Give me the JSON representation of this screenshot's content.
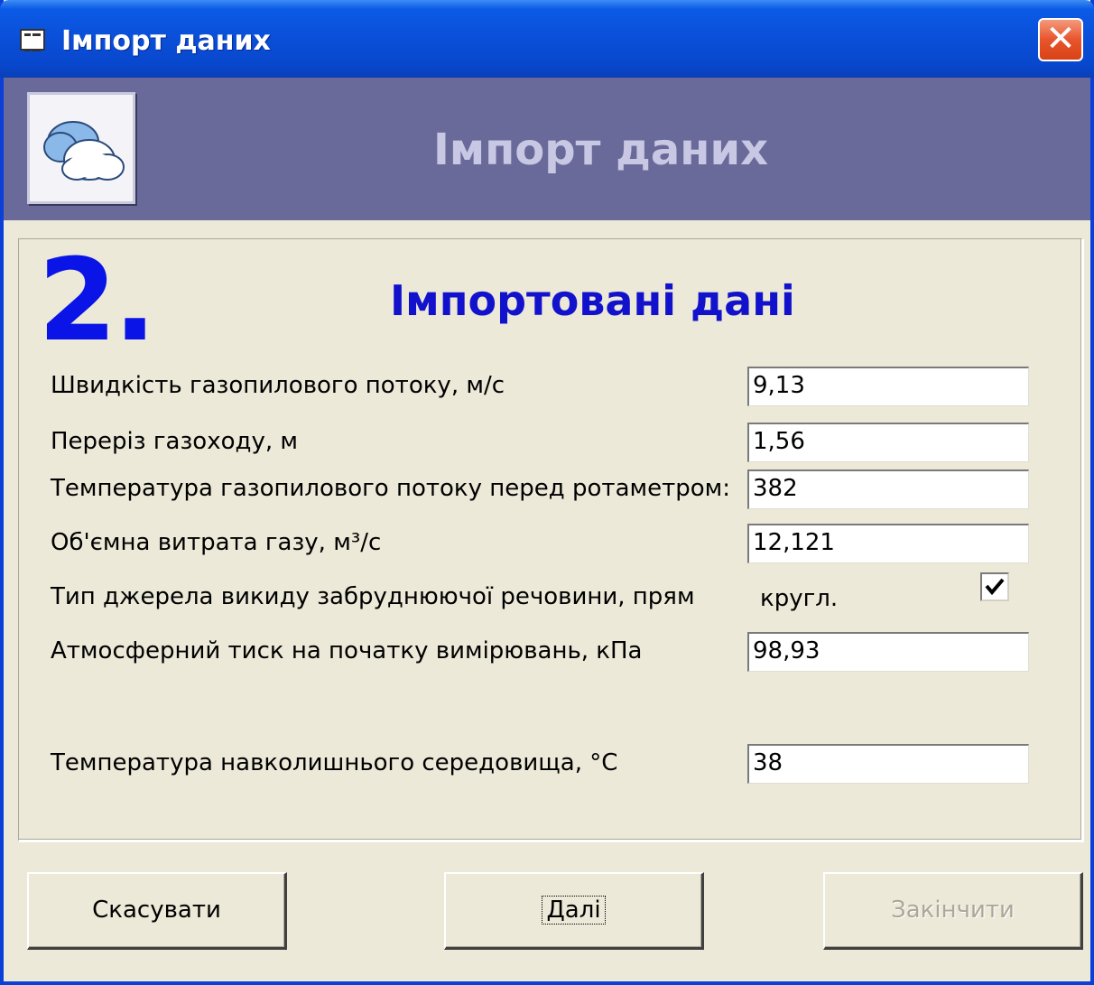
{
  "window": {
    "title": "Імпорт даних",
    "close_label": "✕"
  },
  "banner": {
    "title": "Імпорт даних",
    "icon": "clouds-icon"
  },
  "step": {
    "number": "2.",
    "title": "Імпортовані дані"
  },
  "fields": [
    {
      "label": "Швидкість газопилового потоку, м/с",
      "value": "9,13"
    },
    {
      "label": "Переріз газоходу, м",
      "value": "1,56"
    },
    {
      "label": "Температура газопилового потоку перед ротаметром:",
      "value": "382"
    },
    {
      "label": "Об'ємна витрата газу, м³/с",
      "value": "12,121"
    },
    {
      "label": "Атмосферний тиск на початку вимірювань, кПа",
      "value": "98,93"
    },
    {
      "label": "Температура навколишнього середовища, °С",
      "value": "38"
    }
  ],
  "source_type": {
    "label": "Тип джерела викиду забруднюючої речовини,  прям",
    "option_label": "кругл.",
    "checked": true,
    "check_mark": "✓"
  },
  "buttons": {
    "cancel": "Скасувати",
    "next": "Далі",
    "finish": "Закінчити"
  }
}
